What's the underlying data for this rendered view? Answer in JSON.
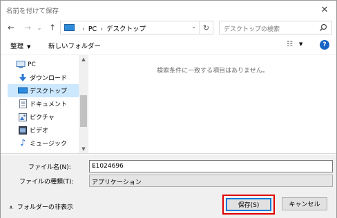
{
  "window": {
    "title": "名前を付けて保存"
  },
  "address_bar": {
    "segments": [
      "PC",
      "デスクトップ"
    ]
  },
  "search": {
    "placeholder": "デスクトップの検索"
  },
  "toolbar": {
    "organize_label": "整理",
    "new_folder_label": "新しいフォルダー"
  },
  "nav_pane": {
    "items": [
      {
        "label": "PC",
        "icon": "pc-icon",
        "level": 0,
        "selected": false
      },
      {
        "label": "ダウンロード",
        "icon": "download-icon",
        "level": 1,
        "selected": false
      },
      {
        "label": "デスクトップ",
        "icon": "desktop-icon",
        "level": 1,
        "selected": true
      },
      {
        "label": "ドキュメント",
        "icon": "document-icon",
        "level": 1,
        "selected": false
      },
      {
        "label": "ピクチャ",
        "icon": "pictures-icon",
        "level": 1,
        "selected": false
      },
      {
        "label": "ビデオ",
        "icon": "video-icon",
        "level": 1,
        "selected": false
      },
      {
        "label": "ミュージック",
        "icon": "music-icon",
        "level": 1,
        "selected": false
      }
    ]
  },
  "content": {
    "empty_message": "検索条件に一致する項目はありません。"
  },
  "form": {
    "filename_label": "ファイル名(N):",
    "filename_value": "E1024696",
    "filetype_label": "ファイルの種類(T):",
    "filetype_value": "アプリケーション"
  },
  "footer": {
    "hide_folders_label": "フォルダーの非表示",
    "save_label": "保存(S)",
    "cancel_label": "キャンセル"
  },
  "colors": {
    "accent": "#0078d7",
    "highlight": "#e00000",
    "selection": "#cce8ff"
  }
}
